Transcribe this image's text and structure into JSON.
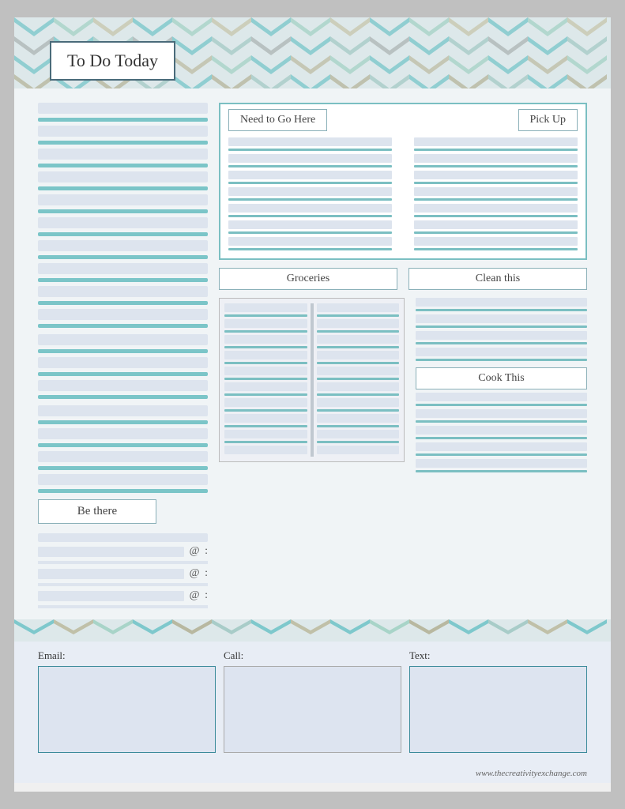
{
  "title": "To Do Today",
  "sections": {
    "need_to_go_here": "Need to Go Here",
    "pick_up": "Pick Up",
    "groceries": "Groceries",
    "clean_this": "Clean this",
    "be_there": "Be there",
    "cook_this": "Cook This",
    "email_label": "Email:",
    "call_label": "Call:",
    "text_label": "Text:"
  },
  "at_symbols": [
    "@",
    "@",
    "@"
  ],
  "colon_symbol": ":",
  "watermark": "www.thecreativityexchange.com"
}
